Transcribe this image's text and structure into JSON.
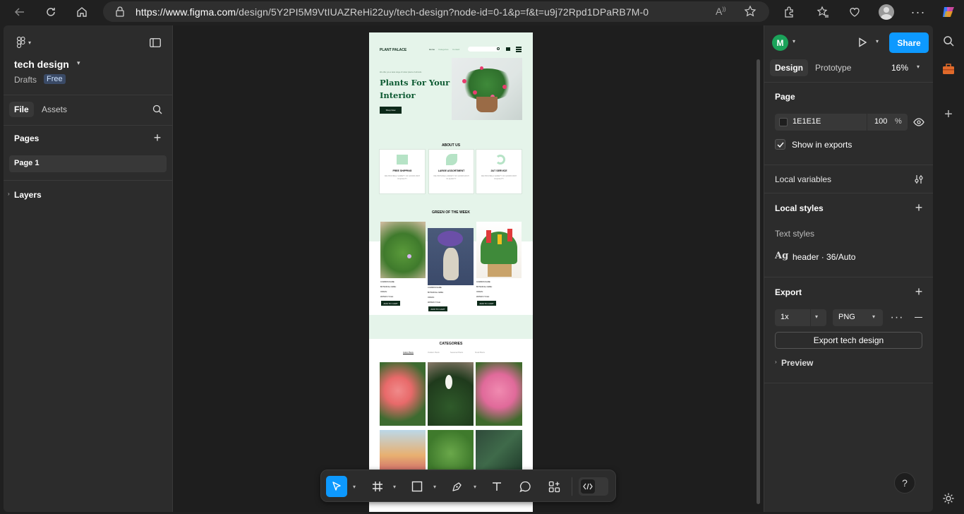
{
  "browser": {
    "url_host": "https://www.figma.com",
    "url_path": "/design/5Y2PI5M9VtIUAZReHi22uy/tech-design?node-id=0-1&p=f&t=u9j72Rpd1DPaRB7M-0"
  },
  "file": {
    "name": "tech design",
    "location": "Drafts",
    "plan_badge": "Free"
  },
  "left_panel": {
    "tab_file": "File",
    "tab_assets": "Assets",
    "pages_heading": "Pages",
    "pages": [
      "Page 1"
    ],
    "layers_heading": "Layers"
  },
  "right_panel": {
    "avatar_letter": "M",
    "share_label": "Share",
    "tab_design": "Design",
    "tab_prototype": "Prototype",
    "zoom": "16%",
    "page_heading": "Page",
    "page_color_hex": "1E1E1E",
    "page_opacity": "100",
    "percent_sign": "%",
    "show_in_exports": "Show in exports",
    "local_variables": "Local variables",
    "local_styles": "Local styles",
    "text_styles": "Text styles",
    "style_glyph": "Ag",
    "style_name": "header · 36/Auto",
    "export_heading": "Export",
    "export_scale": "1x",
    "export_format": "PNG",
    "export_button": "Export tech design",
    "preview_label": "Preview"
  },
  "colors": {
    "accent": "#0d99ff",
    "avatar": "#1ba35a",
    "page_bg": "#1E1E1E",
    "mint": "#e5f4ea",
    "dark_green": "#0d2a1a"
  },
  "design_mock": {
    "brand": "PLANT PALACE",
    "nav": [
      "Home",
      "Categories",
      "Contact"
    ],
    "hero_sub": "We offer you a wide range of indoor plants of all kinds",
    "hero_title_1": "Plants For Your",
    "hero_title_2": "Interior",
    "hero_btn": "Shop Now",
    "about_title": "ABOUT US",
    "about_cards": [
      {
        "title": "FREE SHIPPING",
        "text": "WE PROVIDE A VARIETY OF GOODS RICH IN QUALITY"
      },
      {
        "title": "LARGE ASSORTMENT",
        "text": "WE PROVIDE A VARIETY OF GOODS RICH IN QUALITY"
      },
      {
        "title": "24/7 SERVICE",
        "text": "WE PROVIDE A VARIETY OF GOODS RICH IN QUALITY"
      }
    ],
    "green_title": "GREEN OF THE WEEK",
    "product_lines": [
      "COMMON NAME:",
      "BOTANICAL NAME:",
      "ORIGIN:",
      "WATER CYCLE:"
    ],
    "add_to_cart": "ADD TO CART",
    "categories_title": "CATEGORIES",
    "category_tabs": [
      "Indoor Plants",
      "Outdoor Plants",
      "Seasonal Plants",
      "Small Plants"
    ]
  },
  "toolbar_icons": [
    "move-tool",
    "frame-tool",
    "shape-tool",
    "pen-tool",
    "text-tool",
    "comment-tool",
    "actions-tool",
    "dev-mode-toggle"
  ],
  "help_label": "?"
}
